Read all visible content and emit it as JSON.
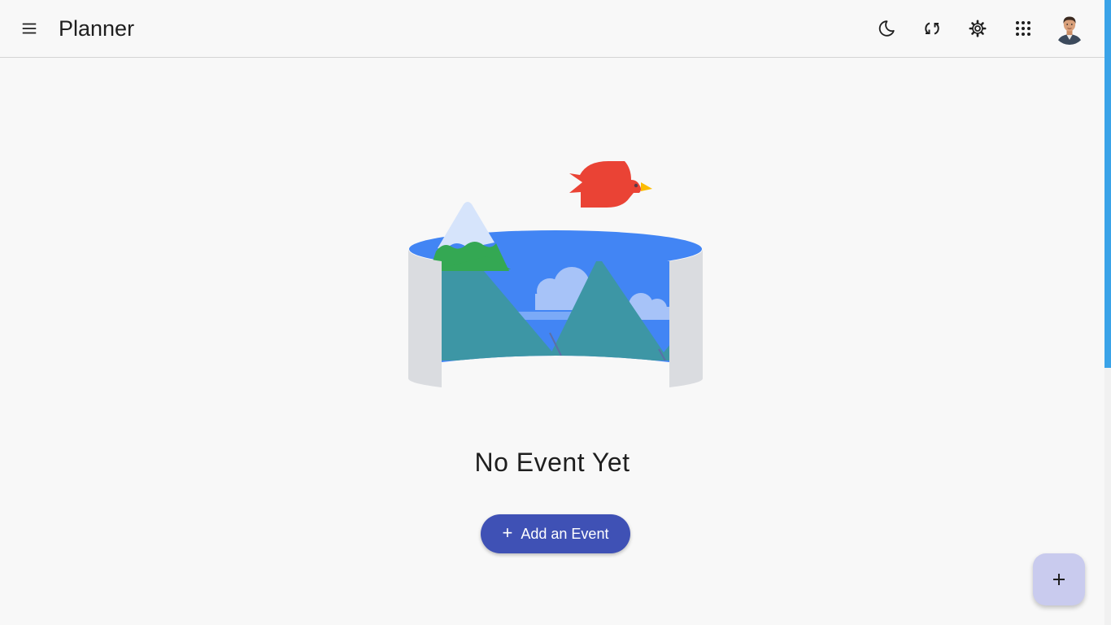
{
  "app": {
    "title": "Planner"
  },
  "toolbar": {
    "icons": [
      "menu-icon",
      "dark-mode-icon",
      "sync-icon",
      "settings-icon",
      "apps-grid-icon",
      "user-avatar"
    ]
  },
  "empty_state": {
    "title": "No Event Yet",
    "add_button_label": "Add an Event"
  },
  "fab": {
    "icon": "plus-icon"
  },
  "colors": {
    "primary_button": "#3f51b5",
    "fab_background": "#c9cbee",
    "scrollbar_thumb": "#3aa3e8",
    "background": "#f8f8f8"
  }
}
